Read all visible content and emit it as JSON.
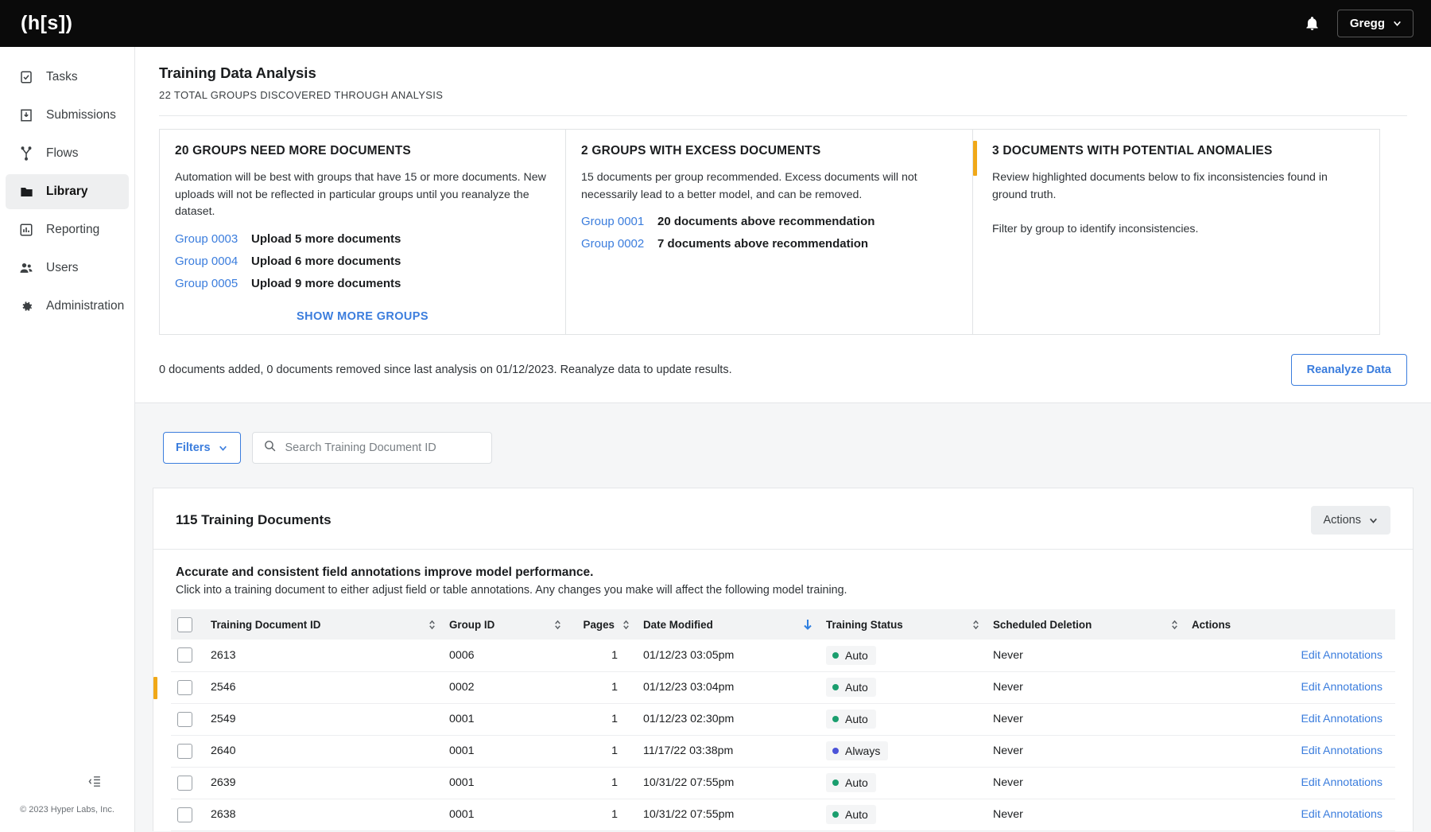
{
  "topbar": {
    "logo": "(h[s])",
    "notifications_icon": "bell-icon",
    "user_name": "Gregg"
  },
  "sidebar": {
    "items": [
      {
        "label": "Tasks",
        "icon": "clipboard-check-icon",
        "active": false
      },
      {
        "label": "Submissions",
        "icon": "inbox-download-icon",
        "active": false
      },
      {
        "label": "Flows",
        "icon": "flow-branch-icon",
        "active": false
      },
      {
        "label": "Library",
        "icon": "folder-icon",
        "active": true
      },
      {
        "label": "Reporting",
        "icon": "bar-chart-icon",
        "active": false
      },
      {
        "label": "Users",
        "icon": "users-icon",
        "active": false
      },
      {
        "label": "Administration",
        "icon": "gear-icon",
        "active": false
      }
    ],
    "collapse_icon": "collapse-panel-icon",
    "copyright": "© 2023 Hyper Labs, Inc."
  },
  "analysis": {
    "title": "Training Data Analysis",
    "subtitle": "22 TOTAL GROUPS DISCOVERED THROUGH ANALYSIS",
    "cards": [
      {
        "heading": "20 GROUPS NEED MORE DOCUMENTS",
        "body": "Automation will be best with groups that have 15 or more documents. New uploads will not be reflected in particular groups until you reanalyze the dataset.",
        "rows": [
          {
            "group": "Group 0003",
            "text": "Upload 5 more documents"
          },
          {
            "group": "Group 0004",
            "text": "Upload 6 more documents"
          },
          {
            "group": "Group 0005",
            "text": "Upload 9 more documents"
          }
        ],
        "show_more": "SHOW MORE GROUPS"
      },
      {
        "heading": "2 GROUPS WITH EXCESS DOCUMENTS",
        "body": "15 documents per group recommended. Excess documents will not necessarily lead to a better model, and can be removed.",
        "rows": [
          {
            "group": "Group 0001",
            "text": "20 documents above recommendation"
          },
          {
            "group": "Group 0002",
            "text": "7 documents above recommendation"
          }
        ]
      },
      {
        "heading": "3 DOCUMENTS WITH POTENTIAL ANOMALIES",
        "body": "Review highlighted documents below to fix inconsistencies found in ground truth.",
        "body2": "Filter by group to identify inconsistencies.",
        "accent_color": "#f0a818"
      }
    ],
    "footer_text": "0 documents added, 0 documents removed since last analysis on 01/12/2023. Reanalyze data to update results.",
    "reanalyze_label": "Reanalyze Data"
  },
  "filterbar": {
    "filters_label": "Filters",
    "search_placeholder": "Search Training Document ID",
    "search_value": "",
    "search_icon": "search-icon",
    "chevron_icon": "chevron-down-icon"
  },
  "table_panel": {
    "title": "115 Training Documents",
    "actions_label": "Actions",
    "note_heading": "Accurate and consistent field annotations improve model performance.",
    "note_body": "Click into a training document to either adjust field or table annotations. Any changes you make will affect the following model training.",
    "columns": [
      {
        "label": "Training Document ID",
        "sortable": true,
        "sorted": "none"
      },
      {
        "label": "Group ID",
        "sortable": true,
        "sorted": "none"
      },
      {
        "label": "Pages",
        "sortable": true,
        "sorted": "none"
      },
      {
        "label": "Date Modified",
        "sortable": true,
        "sorted": "desc"
      },
      {
        "label": "Training Status",
        "sortable": true,
        "sorted": "none"
      },
      {
        "label": "Scheduled Deletion",
        "sortable": true,
        "sorted": "none"
      },
      {
        "label": "Actions",
        "sortable": false,
        "sorted": "none"
      }
    ],
    "action_link_label": "Edit Annotations",
    "rows": [
      {
        "id": "2613",
        "group": "0006",
        "pages": "1",
        "modified": "01/12/23 03:05pm",
        "status": "Auto",
        "status_color": "#1a9e6e",
        "deletion": "Never",
        "flagged": false
      },
      {
        "id": "2546",
        "group": "0002",
        "pages": "1",
        "modified": "01/12/23 03:04pm",
        "status": "Auto",
        "status_color": "#1a9e6e",
        "deletion": "Never",
        "flagged": true
      },
      {
        "id": "2549",
        "group": "0001",
        "pages": "1",
        "modified": "01/12/23 02:30pm",
        "status": "Auto",
        "status_color": "#1a9e6e",
        "deletion": "Never",
        "flagged": false
      },
      {
        "id": "2640",
        "group": "0001",
        "pages": "1",
        "modified": "11/17/22 03:38pm",
        "status": "Always",
        "status_color": "#4b53d8",
        "deletion": "Never",
        "flagged": false
      },
      {
        "id": "2639",
        "group": "0001",
        "pages": "1",
        "modified": "10/31/22 07:55pm",
        "status": "Auto",
        "status_color": "#1a9e6e",
        "deletion": "Never",
        "flagged": false
      },
      {
        "id": "2638",
        "group": "0001",
        "pages": "1",
        "modified": "10/31/22 07:55pm",
        "status": "Auto",
        "status_color": "#1a9e6e",
        "deletion": "Never",
        "flagged": false
      }
    ]
  },
  "colors": {
    "accent_blue": "#3b7ddd",
    "warning": "#f0a818",
    "status_auto": "#1a9e6e",
    "status_always": "#4b53d8"
  }
}
